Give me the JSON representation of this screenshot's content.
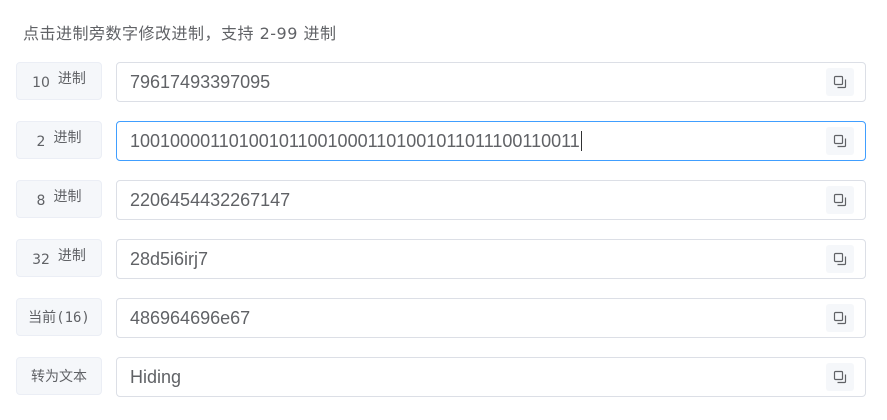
{
  "hint": "点击进制旁数字修改进制，支持 2-99 进制",
  "rows": [
    {
      "base": "10",
      "suffix": "进制",
      "value": "79617493397095",
      "focused": false
    },
    {
      "base": "2",
      "suffix": "进制",
      "value": "1001000011010010110010001101001011011100110011",
      "focused": true
    },
    {
      "base": "8",
      "suffix": "进制",
      "value": "2206454432267147",
      "focused": false
    },
    {
      "base": "32",
      "suffix": "进制",
      "value": "28d5i6irj7",
      "focused": false
    },
    {
      "label": "当前(16)",
      "value": "486964696e67",
      "focused": false
    },
    {
      "label": "转为文本",
      "value": "Hiding",
      "focused": false
    }
  ],
  "icons": {
    "copy": "copy-icon"
  },
  "colors": {
    "focus_border": "#409eff",
    "border": "#dcdfe6",
    "label_bg": "#f5f7fa"
  }
}
